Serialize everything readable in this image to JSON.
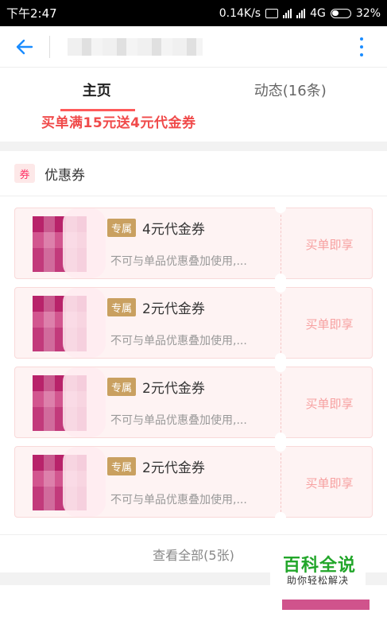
{
  "status_bar": {
    "time": "下午2:47",
    "speed": "0.14K/s",
    "network": "4G",
    "battery": "32%"
  },
  "nav": {
    "back_icon": "arrow-left-icon",
    "more_icon": "more-vertical-icon",
    "accent": "#1a8cff"
  },
  "tabs": [
    {
      "label": "主页",
      "active": true
    },
    {
      "label": "动态(16条)",
      "active": false
    }
  ],
  "promo_text": "买单满15元送4元代金券",
  "coupon_section": {
    "badge": "券",
    "title": "优惠券",
    "coupons": [
      {
        "tag": "专属",
        "title": "4元代金券",
        "desc": "不可与单品优惠叠加使用,...",
        "action": "买单即享"
      },
      {
        "tag": "专属",
        "title": "2元代金券",
        "desc": "不可与单品优惠叠加使用,...",
        "action": "买单即享"
      },
      {
        "tag": "专属",
        "title": "2元代金券",
        "desc": "不可与单品优惠叠加使用,...",
        "action": "买单即享"
      },
      {
        "tag": "专属",
        "title": "2元代金券",
        "desc": "不可与单品优惠叠加使用,...",
        "action": "买单即享"
      }
    ],
    "view_all": "查看全部(5张)"
  },
  "watermark": {
    "title": "百科全说",
    "subtitle": "助你轻松解决"
  }
}
